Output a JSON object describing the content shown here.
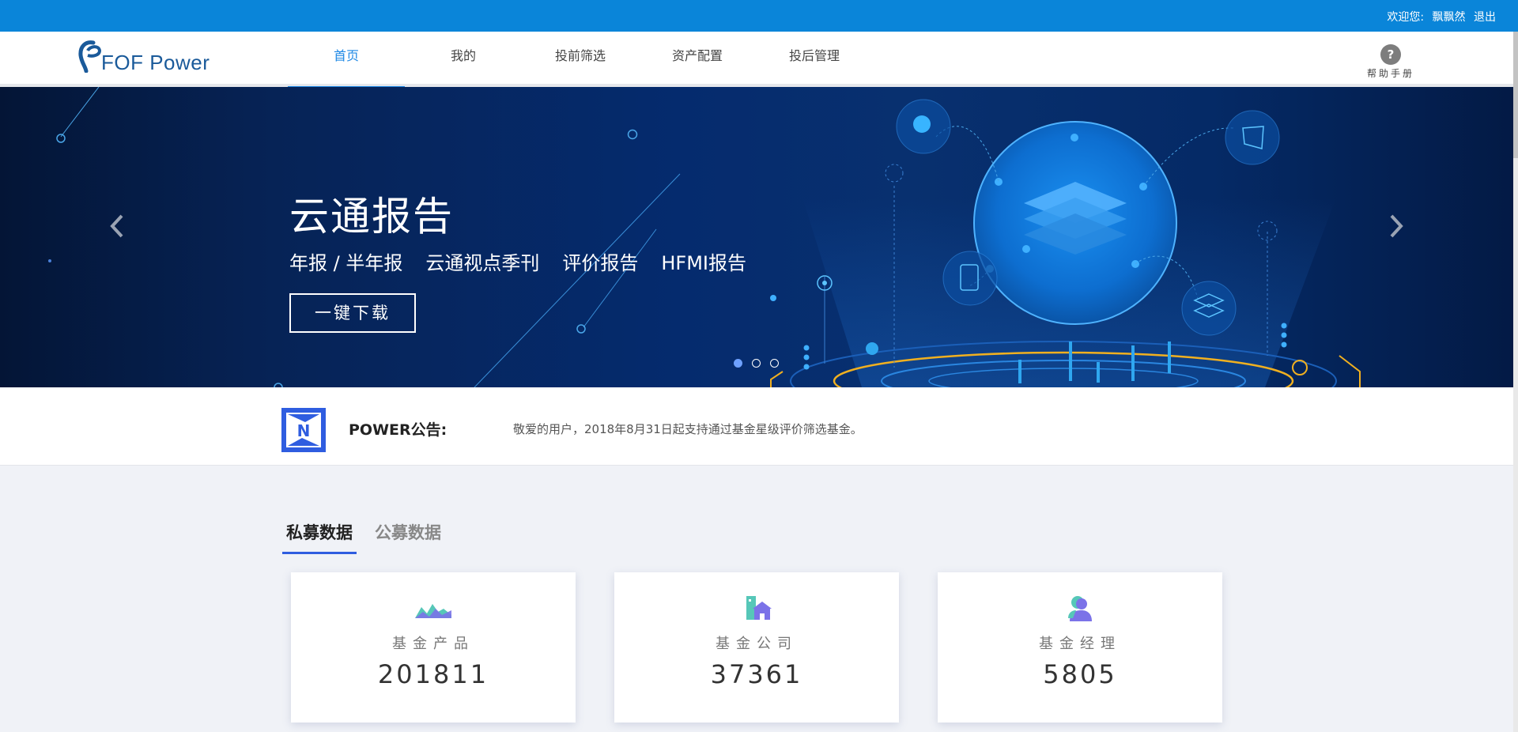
{
  "topbar": {
    "welcome_prefix": "欢迎您:",
    "username": "飘飘然",
    "logout": "退出"
  },
  "header": {
    "logo_text": "FOF Power",
    "nav": [
      {
        "label": "首页",
        "active": true
      },
      {
        "label": "我的",
        "active": false
      },
      {
        "label": "投前筛选",
        "active": false
      },
      {
        "label": "资产配置",
        "active": false
      },
      {
        "label": "投后管理",
        "active": false
      }
    ],
    "help_icon": "?",
    "help_label": "帮助手册"
  },
  "banner": {
    "title": "云通报告",
    "subtitles": [
      "年报 / 半年报",
      "云通视点季刊",
      "评价报告",
      "HFMI报告"
    ],
    "button": "一键下载",
    "prev_icon": "chevron-left-icon",
    "next_icon": "chevron-right-icon",
    "slides": 3,
    "active_slide": 1
  },
  "notice": {
    "icon": "N",
    "label": "POWER公告:",
    "text": "敬爱的用户，2018年8月31日起支持通过基金星级评价筛选基金。"
  },
  "data_tabs": [
    {
      "label": "私募数据",
      "active": true
    },
    {
      "label": "公募数据",
      "active": false
    }
  ],
  "stats": [
    {
      "icon": "chart-area-icon",
      "label": "基金产品",
      "value": "201811"
    },
    {
      "icon": "building-icon",
      "label": "基金公司",
      "value": "37361"
    },
    {
      "icon": "manager-icon",
      "label": "基金经理",
      "value": "5805"
    }
  ],
  "colors": {
    "topbar": "#0a85d9",
    "nav_active": "#1e88e5",
    "tab_active_underline": "#2f5de0",
    "notice_icon": "#2f5de0"
  }
}
